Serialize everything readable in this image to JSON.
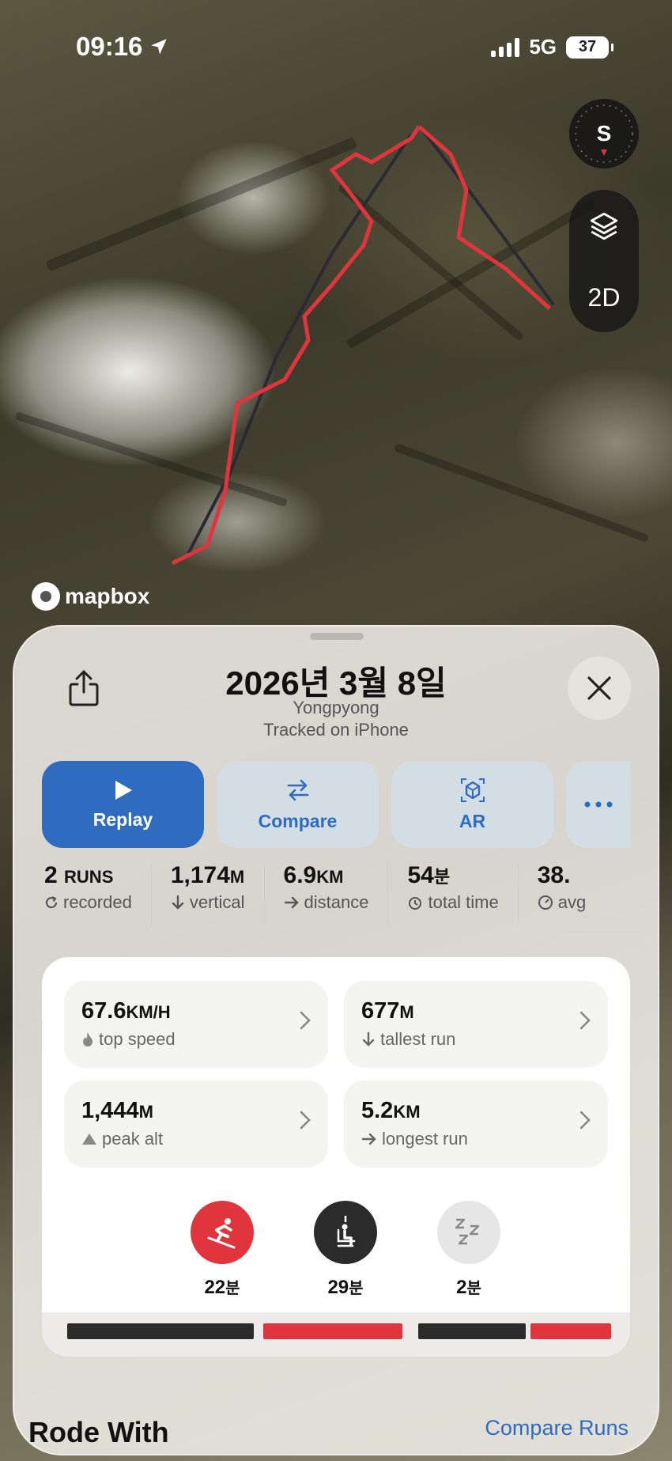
{
  "status_bar": {
    "time": "09:16",
    "network": "5G",
    "battery": "37"
  },
  "map": {
    "compass_label": "S",
    "view_toggle": "2D",
    "attribution": "mapbox",
    "route_color": "#e0353d"
  },
  "sheet": {
    "title": "2026년 3월 8일",
    "location": "Yongpyong",
    "tracked_on": "Tracked on  iPhone",
    "actions": [
      {
        "label": "Replay",
        "icon": "play-icon"
      },
      {
        "label": "Compare",
        "icon": "compare-arrows-icon"
      },
      {
        "label": "AR",
        "icon": "ar-icon"
      },
      {
        "label": "",
        "icon": "more-icon"
      }
    ],
    "stats": [
      {
        "value": "2",
        "unit": "RUNS",
        "label": "recorded"
      },
      {
        "value": "1,174",
        "unit": "M",
        "label": "vertical"
      },
      {
        "value": "6.9",
        "unit": "KM",
        "label": "distance"
      },
      {
        "value": "54",
        "unit": "분",
        "label": "total time"
      },
      {
        "value": "38.",
        "unit": "",
        "label": "avg"
      }
    ],
    "tiles": [
      {
        "value": "67.6",
        "unit": "KM/H",
        "label": "top speed"
      },
      {
        "value": "677",
        "unit": "M",
        "label": "tallest run"
      },
      {
        "value": "1,444",
        "unit": "M",
        "label": "peak alt"
      },
      {
        "value": "5.2",
        "unit": "KM",
        "label": "longest run"
      }
    ],
    "activities": [
      {
        "value": "22",
        "unit": "분",
        "icon": "skier-icon",
        "color": "#e0353d"
      },
      {
        "value": "29",
        "unit": "분",
        "icon": "chairlift-icon",
        "color": "#2b2b2b"
      },
      {
        "value": "2",
        "unit": "분",
        "icon": "sleep-icon",
        "color": "#e6e6e6"
      }
    ],
    "timeline_colors": {
      "run": "#e0353d",
      "lift": "#2b2b2b"
    },
    "rode_with": "Rode With",
    "compare_runs": "Compare Runs"
  }
}
